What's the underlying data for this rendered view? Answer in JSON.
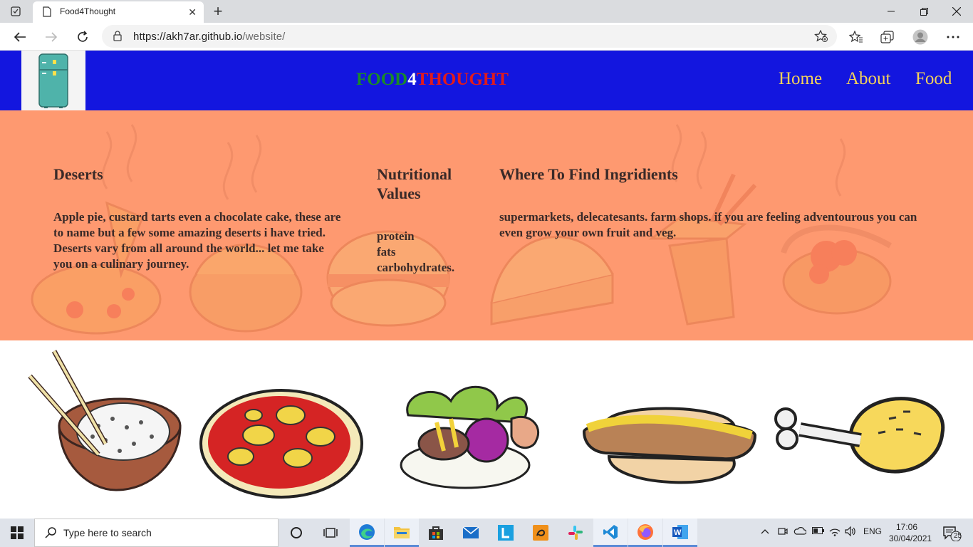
{
  "browser": {
    "tab_title": "Food4Thought",
    "url_host": "https://akh7ar.github.io",
    "url_path": "/website/"
  },
  "site": {
    "brand_part1": "FOOD",
    "brand_part2": "4",
    "brand_part3": "THOUGHT",
    "nav": [
      "Home",
      "About",
      "Food"
    ]
  },
  "info": {
    "deserts": {
      "title": "Deserts",
      "text1": "Apple pie, custard tarts even a chocolate cake, these are to name but a few some amazing deserts i have tried.",
      "text2": "Deserts vary from all around the world... let me take you on a culinary journey."
    },
    "nutrition": {
      "title": "Nutritional Values",
      "items": [
        "protein",
        "fats",
        "carbohydrates."
      ]
    },
    "where": {
      "title": "Where To Find Ingridients",
      "text": "supermarkets, delecatesants. farm shops. if you are feeling adventourous you can even grow your own fruit and veg."
    }
  },
  "gallery": {
    "items": [
      "rice-bowl",
      "pizza",
      "salad-plate",
      "hotdog",
      "chicken-leg"
    ]
  },
  "taskbar": {
    "search_placeholder": "Type here to search",
    "language": "ENG",
    "time": "17:06",
    "date": "30/04/2021",
    "notifications": "25"
  },
  "colors": {
    "header_bg": "#1316df",
    "info_bg": "#fe9970",
    "nav_text": "#f5d35a"
  }
}
